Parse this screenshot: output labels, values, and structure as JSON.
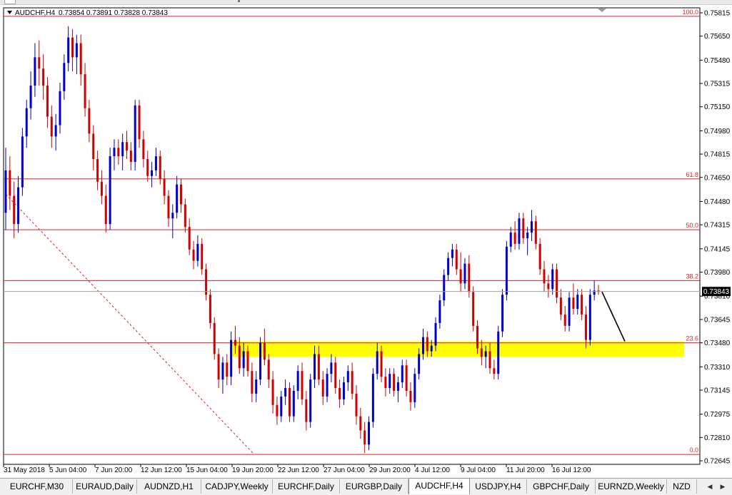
{
  "header": {
    "symbol": "AUDCHF,H4",
    "ohlc": "0.73854 0.73891 0.73828 0.73843",
    "menu_icon": "triangle-down-icon"
  },
  "price_axis": {
    "ticks": [
      "0.75815",
      "0.75650",
      "0.75480",
      "0.75315",
      "0.75150",
      "0.74980",
      "0.74815",
      "0.74650",
      "0.74480",
      "0.74315",
      "0.74145",
      "0.73980",
      "0.73810",
      "0.73645",
      "0.73480",
      "0.73310",
      "0.73145",
      "0.72975",
      "0.72810",
      "0.72645"
    ],
    "current_price": "0.73843"
  },
  "time_axis": {
    "ticks": [
      "31 May 2018",
      "5 Jun 04:00",
      "7 Jun 20:00",
      "12 Jun 12:00",
      "15 Jun 04:00",
      "19 Jun 20:00",
      "22 Jun 12:00",
      "27 Jun 04:00",
      "29 Jun 20:00",
      "4 Jul 12:00",
      "9 Jul 04:00",
      "11 Jul 20:00",
      "16 Jul 12:00"
    ]
  },
  "fibonacci": {
    "levels": [
      {
        "label": "100.0",
        "price": 0.7579
      },
      {
        "label": "61.8",
        "price": 0.7464
      },
      {
        "label": "50.0",
        "price": 0.7428
      },
      {
        "label": "38.2",
        "price": 0.7392
      },
      {
        "label": "23.6",
        "price": 0.7348
      },
      {
        "label": "0.0",
        "price": 0.7269
      }
    ]
  },
  "colors": {
    "bull": "#0000c8",
    "bear": "#d20000",
    "fib": "#e02020",
    "zone": "#ffff00",
    "price_line": "#a0a0a0",
    "background": "#ffffff"
  },
  "tabs": {
    "items": [
      "EURCHF,M30",
      "EURAUD,Daily",
      "AUDNZD,H1",
      "CADJPY,Weekly",
      "EURCHF,Daily",
      "EURGBP,Daily",
      "AUDCHF,H4",
      "USDJPY,H4",
      "GBPCHF,Daily",
      "EURNZD,Weekly",
      "NZD"
    ],
    "active": "AUDCHF,H4",
    "prev_icon": "arrow-left-icon",
    "next_icon": "arrow-right-icon"
  },
  "chart_data": {
    "type": "candlestick",
    "title": "AUDCHF,H4",
    "ylim": [
      0.7262,
      0.7585
    ],
    "support_zone": [
      0.7338,
      0.7349
    ],
    "trend_arrow": {
      "from": 0.7384,
      "to": 0.7349
    },
    "fib_anchor_high": 0.7436,
    "fib_anchor_low": 0.7269,
    "candles": [
      [
        0.744,
        0.7486,
        0.7428,
        0.747
      ],
      [
        0.747,
        0.748,
        0.7442,
        0.7452
      ],
      [
        0.7452,
        0.7462,
        0.7422,
        0.7432
      ],
      [
        0.7432,
        0.7466,
        0.7426,
        0.7458
      ],
      [
        0.7458,
        0.75,
        0.7452,
        0.7494
      ],
      [
        0.7494,
        0.752,
        0.7486,
        0.7514
      ],
      [
        0.7514,
        0.754,
        0.7506,
        0.753
      ],
      [
        0.753,
        0.756,
        0.7522,
        0.755
      ],
      [
        0.755,
        0.7562,
        0.753,
        0.7542
      ],
      [
        0.7542,
        0.7552,
        0.752,
        0.753
      ],
      [
        0.753,
        0.7536,
        0.75,
        0.7508
      ],
      [
        0.7508,
        0.7516,
        0.7486,
        0.7494
      ],
      [
        0.7494,
        0.751,
        0.7484,
        0.7502
      ],
      [
        0.7502,
        0.7532,
        0.7496,
        0.7526
      ],
      [
        0.7526,
        0.7552,
        0.752,
        0.7546
      ],
      [
        0.7546,
        0.7572,
        0.754,
        0.7564
      ],
      [
        0.7564,
        0.757,
        0.754,
        0.755
      ],
      [
        0.755,
        0.7566,
        0.7538,
        0.756
      ],
      [
        0.756,
        0.7566,
        0.753,
        0.7538
      ],
      [
        0.7538,
        0.7546,
        0.7508,
        0.7514
      ],
      [
        0.7514,
        0.752,
        0.749,
        0.7496
      ],
      [
        0.7496,
        0.7502,
        0.747,
        0.7478
      ],
      [
        0.7478,
        0.7484,
        0.7456,
        0.7462
      ],
      [
        0.7462,
        0.747,
        0.7446,
        0.7452
      ],
      [
        0.7452,
        0.746,
        0.7426,
        0.7432
      ],
      [
        0.7432,
        0.7486,
        0.7428,
        0.748
      ],
      [
        0.748,
        0.7492,
        0.747,
        0.7486
      ],
      [
        0.7486,
        0.7492,
        0.7474,
        0.748
      ],
      [
        0.748,
        0.7496,
        0.747,
        0.749
      ],
      [
        0.749,
        0.7498,
        0.7478,
        0.7484
      ],
      [
        0.7484,
        0.749,
        0.747,
        0.7476
      ],
      [
        0.7476,
        0.752,
        0.747,
        0.7516
      ],
      [
        0.7516,
        0.752,
        0.7486,
        0.7492
      ],
      [
        0.7492,
        0.7498,
        0.7472,
        0.7478
      ],
      [
        0.7478,
        0.7484,
        0.7462,
        0.7466
      ],
      [
        0.7466,
        0.7476,
        0.7458,
        0.747
      ],
      [
        0.747,
        0.7486,
        0.7466,
        0.748
      ],
      [
        0.748,
        0.7484,
        0.746,
        0.7464
      ],
      [
        0.7464,
        0.747,
        0.7446,
        0.7452
      ],
      [
        0.7452,
        0.7456,
        0.743,
        0.7436
      ],
      [
        0.7436,
        0.7446,
        0.7422,
        0.744
      ],
      [
        0.744,
        0.7466,
        0.7436,
        0.746
      ],
      [
        0.746,
        0.7464,
        0.744,
        0.7446
      ],
      [
        0.7446,
        0.745,
        0.7426,
        0.743
      ],
      [
        0.743,
        0.7436,
        0.741,
        0.7414
      ],
      [
        0.7414,
        0.742,
        0.74,
        0.7406
      ],
      [
        0.7406,
        0.7424,
        0.7402,
        0.7418
      ],
      [
        0.7418,
        0.7422,
        0.7396,
        0.74
      ],
      [
        0.74,
        0.7404,
        0.7378,
        0.7382
      ],
      [
        0.7382,
        0.7386,
        0.7358,
        0.7362
      ],
      [
        0.7362,
        0.7366,
        0.7336,
        0.734
      ],
      [
        0.734,
        0.7344,
        0.7316,
        0.7322
      ],
      [
        0.7322,
        0.7338,
        0.7312,
        0.7334
      ],
      [
        0.7334,
        0.734,
        0.7318,
        0.7324
      ],
      [
        0.7324,
        0.7356,
        0.7318,
        0.735
      ],
      [
        0.735,
        0.736,
        0.734,
        0.7346
      ],
      [
        0.7346,
        0.7352,
        0.7326,
        0.733
      ],
      [
        0.733,
        0.7348,
        0.7324,
        0.7342
      ],
      [
        0.7342,
        0.7346,
        0.7324,
        0.7328
      ],
      [
        0.7328,
        0.7334,
        0.7306,
        0.7312
      ],
      [
        0.7312,
        0.7328,
        0.7306,
        0.7322
      ],
      [
        0.7322,
        0.7352,
        0.7318,
        0.7348
      ],
      [
        0.7348,
        0.7358,
        0.7332,
        0.7336
      ],
      [
        0.7336,
        0.734,
        0.7316,
        0.7322
      ],
      [
        0.7322,
        0.7328,
        0.7298,
        0.7304
      ],
      [
        0.7304,
        0.731,
        0.729,
        0.7296
      ],
      [
        0.7296,
        0.7314,
        0.7292,
        0.731
      ],
      [
        0.731,
        0.7322,
        0.7304,
        0.7316
      ],
      [
        0.7316,
        0.732,
        0.7292,
        0.7296
      ],
      [
        0.7296,
        0.7318,
        0.7292,
        0.7314
      ],
      [
        0.7314,
        0.7332,
        0.7308,
        0.7328
      ],
      [
        0.7328,
        0.7334,
        0.7304,
        0.7308
      ],
      [
        0.7308,
        0.7314,
        0.7286,
        0.7292
      ],
      [
        0.7292,
        0.7326,
        0.7288,
        0.7322
      ],
      [
        0.7322,
        0.7346,
        0.7316,
        0.734
      ],
      [
        0.734,
        0.7346,
        0.7318,
        0.7322
      ],
      [
        0.7322,
        0.7328,
        0.7304,
        0.731
      ],
      [
        0.731,
        0.733,
        0.7306,
        0.7326
      ],
      [
        0.7326,
        0.734,
        0.732,
        0.7334
      ],
      [
        0.7334,
        0.7338,
        0.7312,
        0.7316
      ],
      [
        0.7316,
        0.7322,
        0.7302,
        0.7308
      ],
      [
        0.7308,
        0.7324,
        0.7304,
        0.732
      ],
      [
        0.732,
        0.7332,
        0.7314,
        0.7328
      ],
      [
        0.7328,
        0.7334,
        0.7308,
        0.7312
      ],
      [
        0.7312,
        0.7318,
        0.729,
        0.7296
      ],
      [
        0.7296,
        0.7302,
        0.728,
        0.7286
      ],
      [
        0.7286,
        0.7292,
        0.727,
        0.7276
      ],
      [
        0.7276,
        0.7296,
        0.7272,
        0.7292
      ],
      [
        0.7292,
        0.733,
        0.7288,
        0.7326
      ],
      [
        0.7326,
        0.7348,
        0.7322,
        0.7342
      ],
      [
        0.7342,
        0.7346,
        0.732,
        0.7324
      ],
      [
        0.7324,
        0.733,
        0.731,
        0.7316
      ],
      [
        0.7316,
        0.733,
        0.7312,
        0.7326
      ],
      [
        0.7326,
        0.733,
        0.731,
        0.7314
      ],
      [
        0.7314,
        0.7324,
        0.7306,
        0.732
      ],
      [
        0.732,
        0.7336,
        0.7316,
        0.7332
      ],
      [
        0.7332,
        0.7336,
        0.731,
        0.7314
      ],
      [
        0.7314,
        0.732,
        0.73,
        0.7306
      ],
      [
        0.7306,
        0.733,
        0.7302,
        0.7326
      ],
      [
        0.7326,
        0.7344,
        0.7322,
        0.734
      ],
      [
        0.734,
        0.7358,
        0.7336,
        0.7352
      ],
      [
        0.7352,
        0.7356,
        0.7338,
        0.7342
      ],
      [
        0.7342,
        0.735,
        0.7338,
        0.7346
      ],
      [
        0.7346,
        0.7366,
        0.7342,
        0.7362
      ],
      [
        0.7362,
        0.7382,
        0.7358,
        0.7378
      ],
      [
        0.7378,
        0.74,
        0.7374,
        0.7396
      ],
      [
        0.7396,
        0.7412,
        0.7392,
        0.7408
      ],
      [
        0.7408,
        0.7418,
        0.7402,
        0.7414
      ],
      [
        0.7414,
        0.7418,
        0.7396,
        0.74
      ],
      [
        0.74,
        0.7412,
        0.7384,
        0.739
      ],
      [
        0.739,
        0.7408,
        0.7386,
        0.7404
      ],
      [
        0.7404,
        0.741,
        0.738,
        0.7384
      ],
      [
        0.7384,
        0.7388,
        0.7356,
        0.736
      ],
      [
        0.736,
        0.7364,
        0.734,
        0.7344
      ],
      [
        0.7344,
        0.735,
        0.7332,
        0.7338
      ],
      [
        0.7338,
        0.7346,
        0.733,
        0.7342
      ],
      [
        0.7342,
        0.7348,
        0.7326,
        0.733
      ],
      [
        0.733,
        0.7336,
        0.7322,
        0.7326
      ],
      [
        0.7326,
        0.736,
        0.7322,
        0.7356
      ],
      [
        0.7356,
        0.7386,
        0.7352,
        0.7382
      ],
      [
        0.7382,
        0.742,
        0.7378,
        0.7416
      ],
      [
        0.7416,
        0.743,
        0.7412,
        0.7426
      ],
      [
        0.7426,
        0.7434,
        0.7414,
        0.7418
      ],
      [
        0.7418,
        0.744,
        0.7414,
        0.7436
      ],
      [
        0.7436,
        0.744,
        0.7418,
        0.7422
      ],
      [
        0.7422,
        0.743,
        0.741,
        0.7426
      ],
      [
        0.7426,
        0.7442,
        0.742,
        0.7434
      ],
      [
        0.7434,
        0.7438,
        0.7414,
        0.7418
      ],
      [
        0.7418,
        0.7422,
        0.7396,
        0.74
      ],
      [
        0.74,
        0.7406,
        0.7384,
        0.739
      ],
      [
        0.739,
        0.7396,
        0.738,
        0.7386
      ],
      [
        0.7386,
        0.7404,
        0.7382,
        0.74
      ],
      [
        0.74,
        0.7404,
        0.7376,
        0.738
      ],
      [
        0.738,
        0.7386,
        0.7364,
        0.7368
      ],
      [
        0.7368,
        0.7374,
        0.7356,
        0.736
      ],
      [
        0.736,
        0.7384,
        0.7356,
        0.738
      ],
      [
        0.738,
        0.739,
        0.7368,
        0.7372
      ],
      [
        0.7372,
        0.7386,
        0.7368,
        0.7382
      ],
      [
        0.7382,
        0.7386,
        0.7364,
        0.7368
      ],
      [
        0.7368,
        0.7374,
        0.7344,
        0.735
      ],
      [
        0.735,
        0.7386,
        0.7346,
        0.7382
      ],
      [
        0.7382,
        0.7392,
        0.7378,
        0.7385
      ],
      [
        0.7385,
        0.7389,
        0.7382,
        0.7384
      ]
    ]
  }
}
